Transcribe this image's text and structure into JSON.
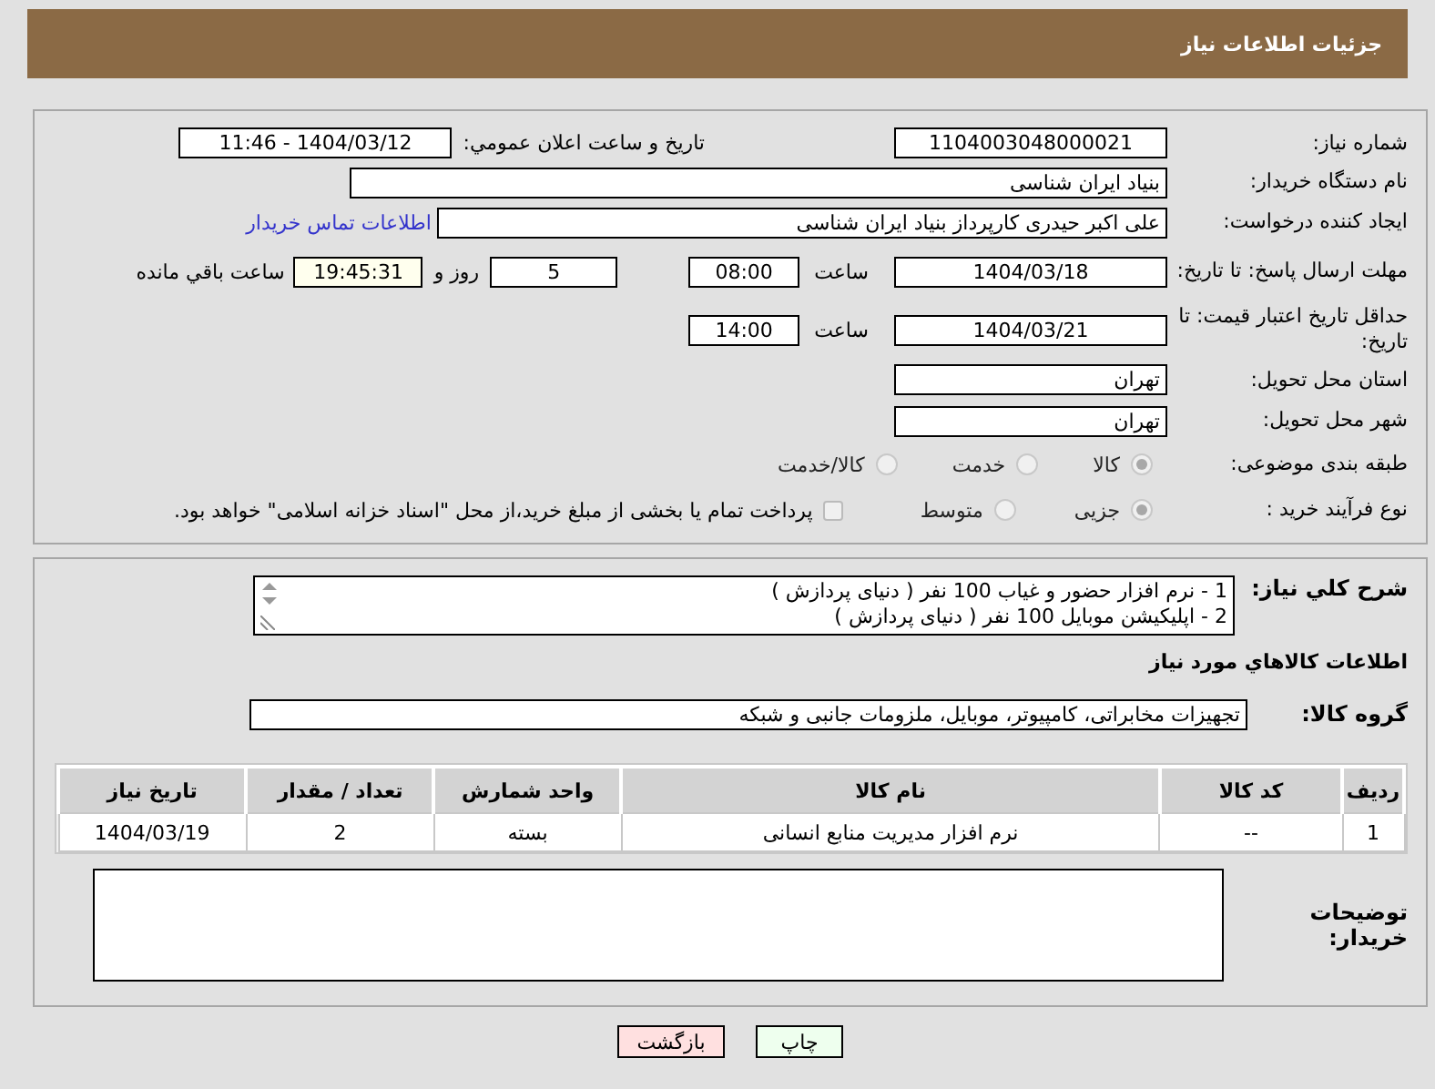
{
  "header": {
    "title": "جزئیات اطلاعات نیاز"
  },
  "need_number": {
    "label": "شماره نیاز:",
    "value": "1104003048000021"
  },
  "announce": {
    "label": "تاریخ و ساعت اعلان عمومي:",
    "value": "1404/03/12 - 11:46"
  },
  "buyer_org": {
    "label": "نام دستگاه خریدار:",
    "value": "بنیاد ایران شناسی"
  },
  "requester": {
    "label": "ایجاد کننده درخواست:",
    "value": "علی اکبر حیدری کارپرداز بنیاد ایران شناسی",
    "link": "اطلاعات تماس خریدار"
  },
  "reply_deadline": {
    "label": "مهلت ارسال پاسخ: تا تاریخ:",
    "date": "1404/03/18",
    "time_label": "ساعت",
    "time": "08:00",
    "days": "5",
    "days_label": "روز و",
    "remaining": "19:45:31",
    "remaining_label": "ساعت باقي مانده"
  },
  "price_validity": {
    "label": "حداقل تاریخ اعتبار قیمت: تا تاریخ:",
    "date": "1404/03/21",
    "time_label": "ساعت",
    "time": "14:00"
  },
  "province": {
    "label": "استان محل تحویل:",
    "value": "تهران"
  },
  "city": {
    "label": "شهر محل تحویل:",
    "value": "تهران"
  },
  "category": {
    "label": "طبقه بندی موضوعی:",
    "options": [
      {
        "label": "کالا",
        "selected": true
      },
      {
        "label": "خدمت",
        "selected": false
      },
      {
        "label": "کالا/خدمت",
        "selected": false
      }
    ]
  },
  "process": {
    "label": "نوع فرآیند خرید :",
    "options": [
      {
        "label": "جزیی",
        "selected": true
      },
      {
        "label": "متوسط",
        "selected": false
      }
    ],
    "treasury": {
      "label": "پرداخت تمام یا بخشی از مبلغ خرید،از محل \"اسناد خزانه اسلامی\" خواهد بود.",
      "checked": false
    }
  },
  "description": {
    "label": "شرح کلي نياز:",
    "lines": [
      "1 - نرم افزار حضور و غیاب 100 نفر ( دنیای پردازش )",
      "2 - اپلیکیشن موبایل 100 نفر ( دنیای پردازش )"
    ]
  },
  "goods_section": {
    "title": "اطلاعات کالاهاي مورد نياز"
  },
  "goods_group": {
    "label": "گروه کالا:",
    "value": "تجهیزات مخابراتی، کامپیوتر، موبایل، ملزومات جانبی و شبکه"
  },
  "table": {
    "columns": [
      "ردیف",
      "کد کالا",
      "نام کالا",
      "واحد شمارش",
      "تعداد / مقدار",
      "تاریخ نیاز"
    ],
    "rows": [
      [
        "1",
        "--",
        "نرم افزار مدیریت منابع انسانی",
        "بسته",
        "2",
        "1404/03/19"
      ]
    ]
  },
  "buyer_notes": {
    "label": "توضیحات خریدار:"
  },
  "buttons": [
    {
      "label": "چاپ",
      "kind": "print"
    },
    {
      "label": "بازگشت",
      "kind": "back"
    }
  ]
}
